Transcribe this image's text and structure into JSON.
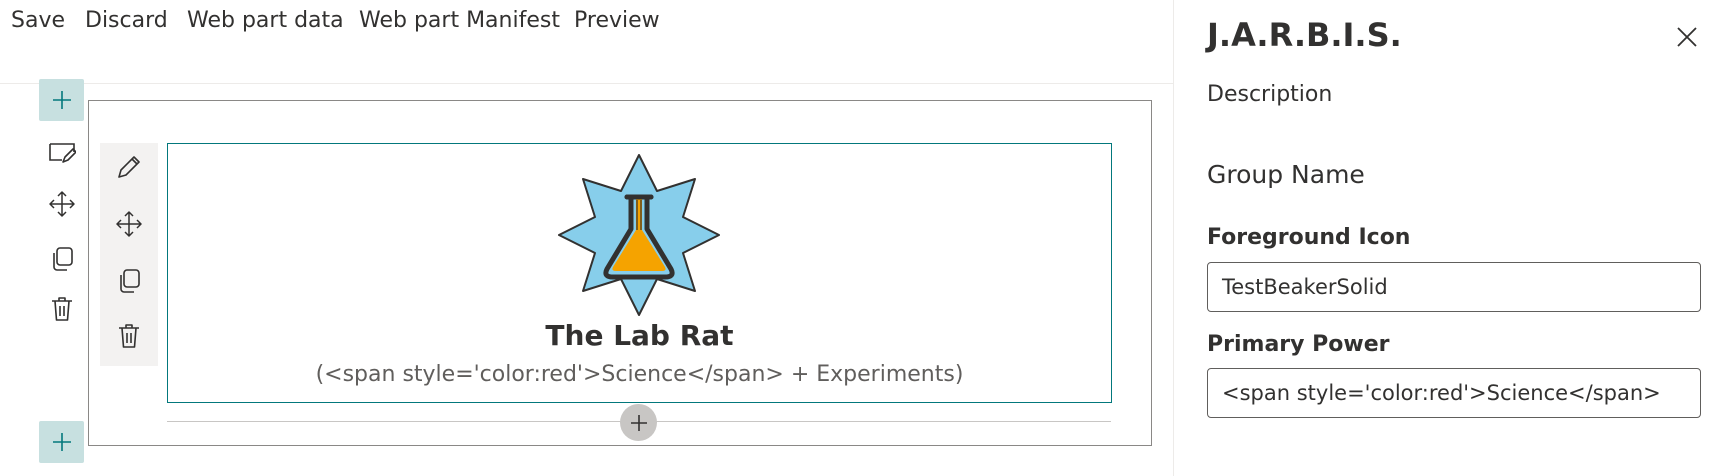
{
  "toolbar": {
    "save": "Save",
    "discard": "Discard",
    "web_part_data": "Web part data",
    "web_part_manifest": "Web part Manifest",
    "preview": "Preview"
  },
  "webpart": {
    "title": "The Lab Rat",
    "subtitle": "(<span style='color:red'>Science</span> + Experiments)",
    "icon": "test-beaker-solid-icon"
  },
  "property_pane": {
    "title": "J.A.R.B.I.S.",
    "description": "Description",
    "group_name": "Group Name",
    "fields": [
      {
        "label": "Foreground Icon",
        "value": "TestBeakerSolid"
      },
      {
        "label": "Primary Power",
        "value": "<span style='color:red'>Science</span>"
      }
    ]
  },
  "colors": {
    "accent_teal": "#03787c",
    "add_button_bg": "#c7e0e0",
    "star_fill": "#87ceeb",
    "beaker_fill": "#f5a300"
  }
}
